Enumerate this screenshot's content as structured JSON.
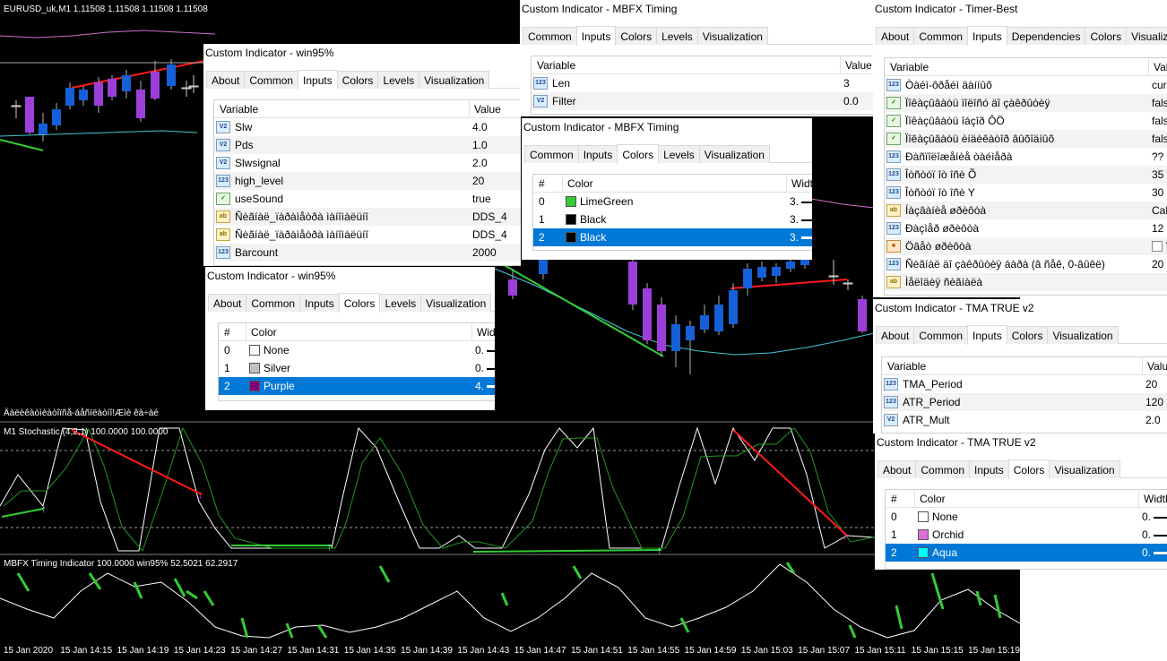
{
  "colors": {
    "chart_bg": "#000000",
    "candle_bull": "#1560d8",
    "candle_bear": "#9b3fd8",
    "band_upper": "#d070d0",
    "band_lower": "#40c8d8",
    "trend_red": "#ff1a1a",
    "trend_green": "#32cd32",
    "stoch_main": "#ffffff",
    "stoch_signal": "#1f9a1f",
    "timing_green": "#32cd32",
    "selection": "#0078d7"
  },
  "chart": {
    "symbol_label": "EURUSD_uk,M1  1.11508 1.11508 1.11508 1.11508",
    "indicator_caption": "Äàëèêàòìèàòîïñå-áåñïëàòíî!Æìè êà÷àé",
    "stochastic_label": "M1 Stochastic (4,2,1) 100.0000 100.0000",
    "timing_label": "MBFX Timing Indicator 100.0000   win95% 52.5021 62.2917",
    "time_axis": [
      "15 Jan 2020",
      "15 Jan 14:15",
      "15 Jan 14:19",
      "15 Jan 14:23",
      "15 Jan 14:27",
      "15 Jan 14:31",
      "15 Jan 14:35",
      "15 Jan 14:39",
      "15 Jan 14:43",
      "15 Jan 14:47",
      "15 Jan 14:51",
      "15 Jan 14:55",
      "15 Jan 14:59",
      "15 Jan 15:03",
      "15 Jan 15:07",
      "15 Jan 15:11",
      "15 Jan 15:15",
      "15 Jan 15:19"
    ]
  },
  "dialogs": {
    "win95_inputs": {
      "title": "Custom Indicator - win95%",
      "tabs": [
        "About",
        "Common",
        "Inputs",
        "Colors",
        "Levels",
        "Visualization"
      ],
      "active_tab": "Inputs",
      "headers": [
        "Variable",
        "Value"
      ],
      "rows": [
        {
          "icon": "numeric-icon",
          "name": "Slw",
          "value": "4.0"
        },
        {
          "icon": "numeric-icon",
          "name": "Pds",
          "value": "1.0"
        },
        {
          "icon": "numeric-icon",
          "name": "Slwsignal",
          "value": "2.0"
        },
        {
          "icon": "integer-icon",
          "name": "high_level",
          "value": "20"
        },
        {
          "icon": "bool-icon",
          "name": "useSound",
          "value": "true"
        },
        {
          "icon": "string-icon",
          "name": "Ñèãíàë_ïàðàìåòðà ìàíîìàëüíî",
          "value": "DDS_4"
        },
        {
          "icon": "string-icon",
          "name": "Ñèãíàë_ïàðàìåòðà ìàíîìàëüíî",
          "value": "DDS_4"
        },
        {
          "icon": "integer-icon",
          "name": "Barcount",
          "value": "2000"
        }
      ]
    },
    "win95_colors": {
      "title": "Custom Indicator - win95%",
      "tabs": [
        "About",
        "Common",
        "Inputs",
        "Colors",
        "Levels",
        "Visualization"
      ],
      "active_tab": "Colors",
      "headers": [
        "#",
        "Color",
        "Width"
      ],
      "rows": [
        {
          "index": "0",
          "color_name": "None",
          "swatch": "#ffffff",
          "width": "0.",
          "selected": false
        },
        {
          "index": "1",
          "color_name": "Silver",
          "swatch": "#c0c0c0",
          "width": "0.",
          "selected": false
        },
        {
          "index": "2",
          "color_name": "Purple",
          "swatch": "#800080",
          "width": "4.",
          "selected": true
        }
      ]
    },
    "mbfx_inputs": {
      "title": "Custom Indicator - MBFX Timing",
      "tabs": [
        "Common",
        "Inputs",
        "Colors",
        "Levels",
        "Visualization"
      ],
      "active_tab": "Inputs",
      "headers": [
        "Variable",
        "Value"
      ],
      "rows": [
        {
          "icon": "integer-icon",
          "name": "Len",
          "value": "3"
        },
        {
          "icon": "numeric-icon",
          "name": "Filter",
          "value": "0.0"
        }
      ]
    },
    "mbfx_colors": {
      "title": "Custom Indicator - MBFX Timing",
      "tabs": [
        "Common",
        "Inputs",
        "Colors",
        "Levels",
        "Visualization"
      ],
      "active_tab": "Colors",
      "headers": [
        "#",
        "Color",
        "Width"
      ],
      "rows": [
        {
          "index": "0",
          "color_name": "LimeGreen",
          "swatch": "#32cd32",
          "width": "3.",
          "selected": false
        },
        {
          "index": "1",
          "color_name": "Black",
          "swatch": "#000000",
          "width": "3.",
          "selected": false
        },
        {
          "index": "2",
          "color_name": "Black",
          "swatch": "#000000",
          "width": "3.",
          "selected": true
        }
      ]
    },
    "timer_best": {
      "title": "Custom Indicator - Timer-Best",
      "tabs": [
        "About",
        "Common",
        "Inputs",
        "Dependencies",
        "Colors",
        "Visualization"
      ],
      "active_tab": "Inputs",
      "headers": [
        "Variable",
        "Value"
      ],
      "rows": [
        {
          "icon": "integer-icon",
          "name": "Òàéì-ôðåéì äàííûõ",
          "value": "curren"
        },
        {
          "icon": "bool-icon",
          "name": "Ïîêàçûâàòü ïîëîñó äî çàêðûòèÿ",
          "value": "false"
        },
        {
          "icon": "bool-icon",
          "name": "Ïîêàçûâàòü îáçîð ÔÖ",
          "value": "false"
        },
        {
          "icon": "bool-icon",
          "name": "Ïîêàçûâàòü èíäèêàòîð âûõîäíûõ",
          "value": "false"
        },
        {
          "icon": "integer-icon",
          "name": "Ðàñïîëîæåíèå òàéìåðà",
          "value": "?? ??"
        },
        {
          "icon": "integer-icon",
          "name": "Îòñòóï îò îñè Õ",
          "value": "35"
        },
        {
          "icon": "integer-icon",
          "name": "Îòñòóï îò îñè Y",
          "value": "30"
        },
        {
          "icon": "string-icon",
          "name": "Íàçâàíèå øðèôòà",
          "value": "Calibri"
        },
        {
          "icon": "integer-icon",
          "name": "Ðàçìåð øðèôòà",
          "value": "12"
        },
        {
          "icon": "color-icon",
          "name": "Öâåò øðèôòà",
          "value": "Wh",
          "swatch": "#ffffff"
        },
        {
          "icon": "integer-icon",
          "name": "Ñèãíàë äî çàêðûòèÿ áàðà (â ñåê, 0-âûêë)",
          "value": "20"
        },
        {
          "icon": "string-icon",
          "name": "Ìåëîäèÿ ñèãíàëà",
          "value": ""
        }
      ]
    },
    "tma_inputs": {
      "title": "Custom Indicator - TMA TRUE v2",
      "tabs": [
        "About",
        "Common",
        "Inputs",
        "Colors",
        "Visualization"
      ],
      "active_tab": "Inputs",
      "headers": [
        "Variable",
        "Value"
      ],
      "rows": [
        {
          "icon": "integer-icon",
          "name": "TMA_Period",
          "value": "20"
        },
        {
          "icon": "integer-icon",
          "name": "ATR_Period",
          "value": "120"
        },
        {
          "icon": "numeric-icon",
          "name": "ATR_Mult",
          "value": "2.0"
        }
      ]
    },
    "tma_colors": {
      "title": "Custom Indicator - TMA TRUE v2",
      "tabs": [
        "About",
        "Common",
        "Inputs",
        "Colors",
        "Visualization"
      ],
      "active_tab": "Colors",
      "headers": [
        "#",
        "Color",
        "Width"
      ],
      "rows": [
        {
          "index": "0",
          "color_name": "None",
          "swatch": "#ffffff",
          "width": "0.",
          "selected": false
        },
        {
          "index": "1",
          "color_name": "Orchid",
          "swatch": "#da70d6",
          "width": "0.",
          "selected": false
        },
        {
          "index": "2",
          "color_name": "Aqua",
          "swatch": "#00ffff",
          "width": "0.",
          "selected": true
        }
      ]
    }
  }
}
